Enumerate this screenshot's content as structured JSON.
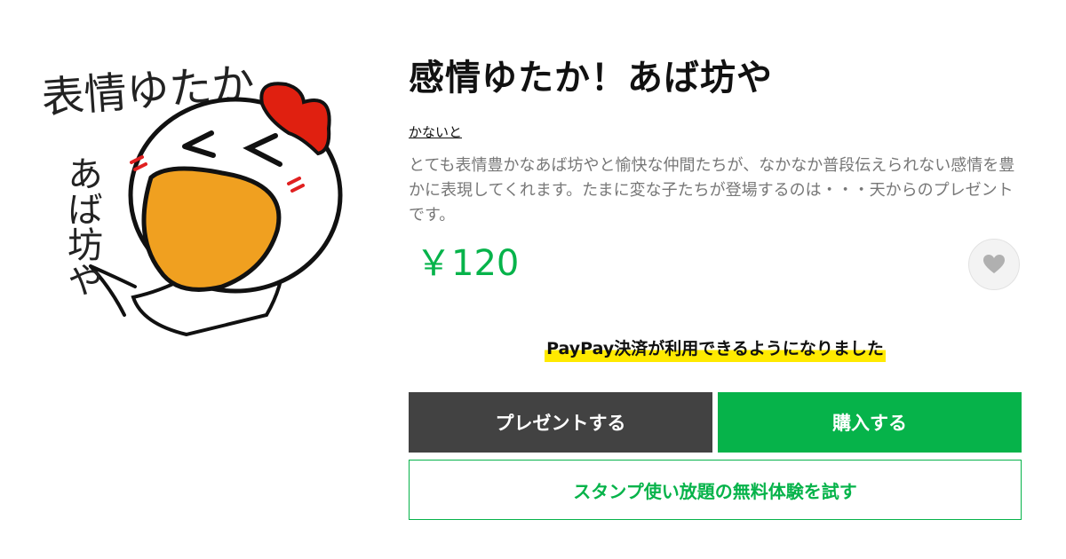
{
  "product": {
    "title": "感情ゆたか！あば坊や",
    "author": "かないと",
    "description": "とても表情豊かなあば坊やと愉快な仲間たちが、なかなか普段伝えられない感情を豊かに表現してくれます。たまに変な子たちが登場するのは・・・天からのプレゼントです。",
    "price": "￥120",
    "image": {
      "lettering_top": "表情ゆたか",
      "lettering_side": "あば坊や"
    }
  },
  "favorite": {
    "icon": "heart-icon"
  },
  "notice": "PayPay決済が利用できるようになりました",
  "buttons": {
    "present": "プレゼントする",
    "buy": "購入する",
    "trial": "スタンプ使い放題の無料体験を試す"
  },
  "colors": {
    "accent": "#06b34a",
    "dark_button": "#424242",
    "highlight": "#ffea00",
    "mascot_beak": "#f0a020",
    "mascot_crest": "#e02010"
  }
}
